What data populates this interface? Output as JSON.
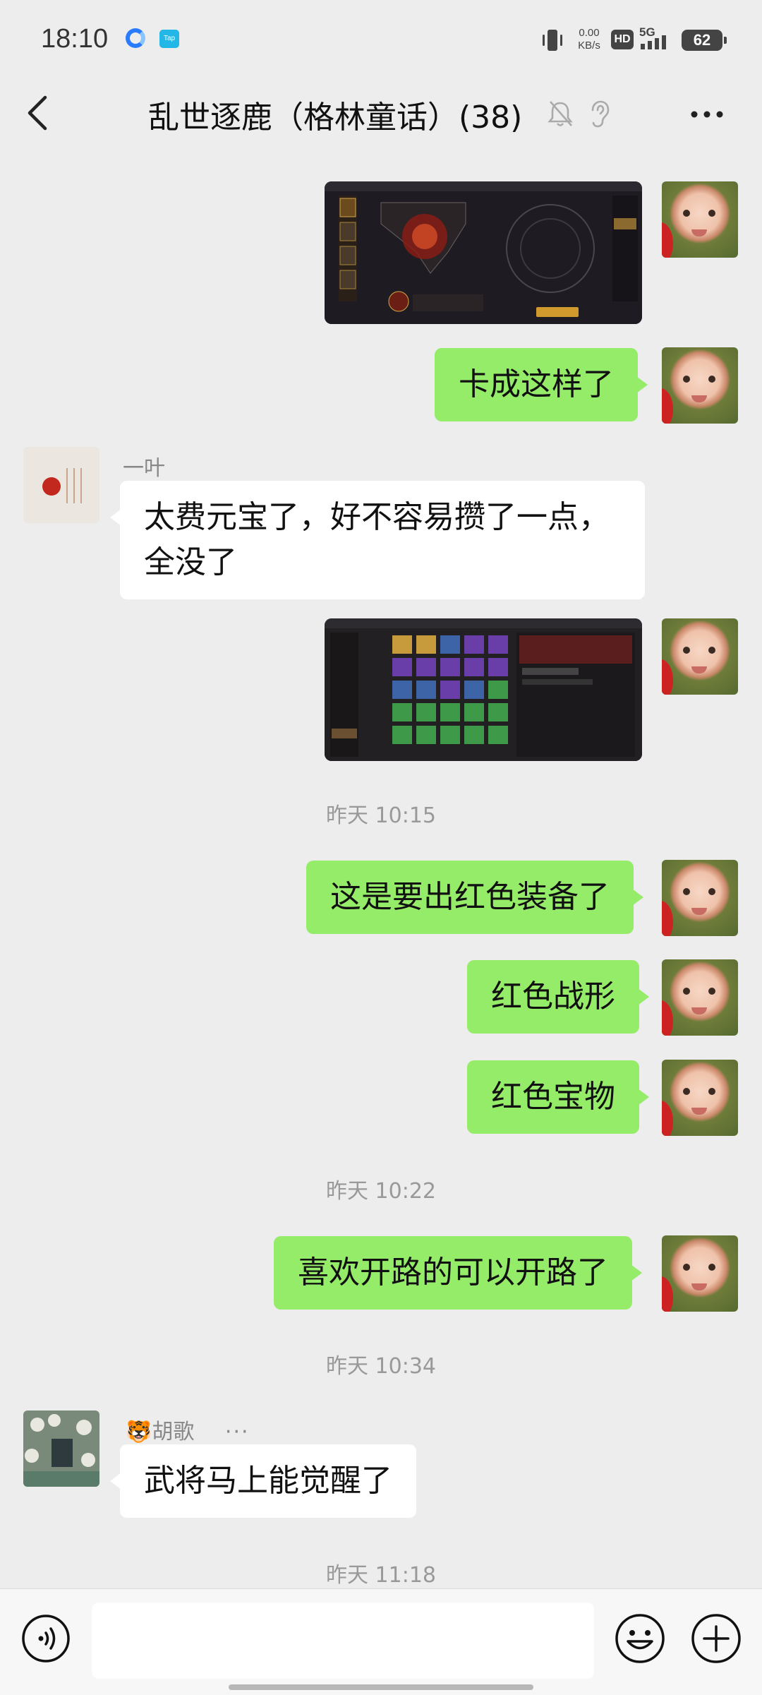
{
  "status_bar": {
    "time": "18:10",
    "app_badge": "Tap",
    "net_speed_value": "0.00",
    "net_speed_unit": "KB/s",
    "hd_label": "HD",
    "network_type": "5G",
    "battery": "62"
  },
  "header": {
    "title": "乱世逐鹿（格林童话）(38)",
    "icons": [
      "back-icon",
      "mute-bell-icon",
      "ear-icon",
      "more-icon"
    ]
  },
  "messages": [
    {
      "type": "image",
      "direction": "out",
      "image_kind": "game-screenshot"
    },
    {
      "type": "text",
      "direction": "out",
      "text": "卡成这样了"
    },
    {
      "type": "text",
      "direction": "in",
      "sender": "一叶",
      "text": "太费元宝了，好不容易攒了一点，全没了"
    },
    {
      "type": "image",
      "direction": "out",
      "image_kind": "game-screenshot"
    },
    {
      "type": "time",
      "text": "昨天 10:15"
    },
    {
      "type": "text",
      "direction": "out",
      "text": "这是要出红色装备了"
    },
    {
      "type": "text",
      "direction": "out",
      "text": "红色战形"
    },
    {
      "type": "text",
      "direction": "out",
      "text": "红色宝物"
    },
    {
      "type": "time",
      "text": "昨天 10:22"
    },
    {
      "type": "text",
      "direction": "out",
      "text": "喜欢开路的可以开路了"
    },
    {
      "type": "time",
      "text": "昨天 10:34"
    },
    {
      "type": "text",
      "direction": "in",
      "sender": "胡歌",
      "sender_emoji": "🐯",
      "sender_extra": "···",
      "text": "武将马上能觉醒了"
    },
    {
      "type": "time",
      "text": "昨天 11:18"
    }
  ],
  "input_bar": {
    "placeholder": "",
    "icons": [
      "voice-icon",
      "emoji-icon",
      "plus-icon"
    ]
  },
  "colors": {
    "background": "#ededed",
    "outgoing_bubble": "#95ec69",
    "incoming_bubble": "#ffffff"
  }
}
